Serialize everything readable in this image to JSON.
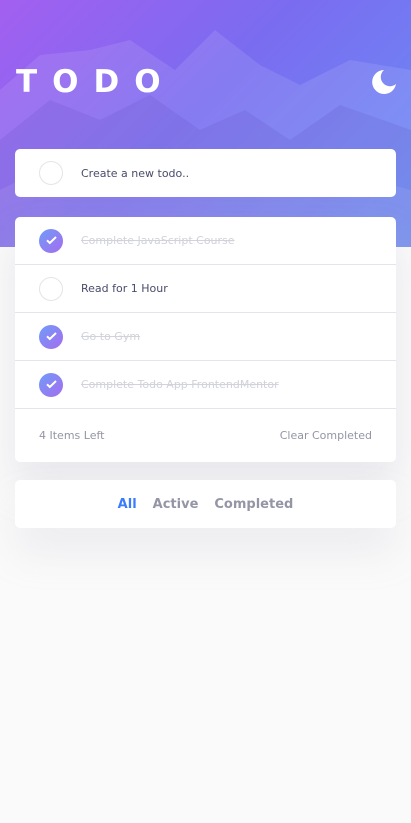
{
  "header": {
    "title": "TODO",
    "theme_icon": "moon-icon"
  },
  "new_todo": {
    "placeholder": "Create a new todo.."
  },
  "todos": [
    {
      "text": "Complete JavaScript Course",
      "completed": true
    },
    {
      "text": "Read for 1 Hour",
      "completed": false
    },
    {
      "text": "Go to Gym",
      "completed": true
    },
    {
      "text": "Complete Todo App FrontendMentor",
      "completed": true
    }
  ],
  "footer": {
    "items_left": "4 Items Left",
    "clear_label": "Clear Completed"
  },
  "filters": {
    "all": "All",
    "active": "Active",
    "completed": "Completed",
    "selected": "All"
  },
  "colors": {
    "accent": "#3a7cfd",
    "check_start": "#6f9cf8",
    "check_end": "#a66cf0",
    "text": "#494c6b",
    "muted": "#9495a5"
  }
}
